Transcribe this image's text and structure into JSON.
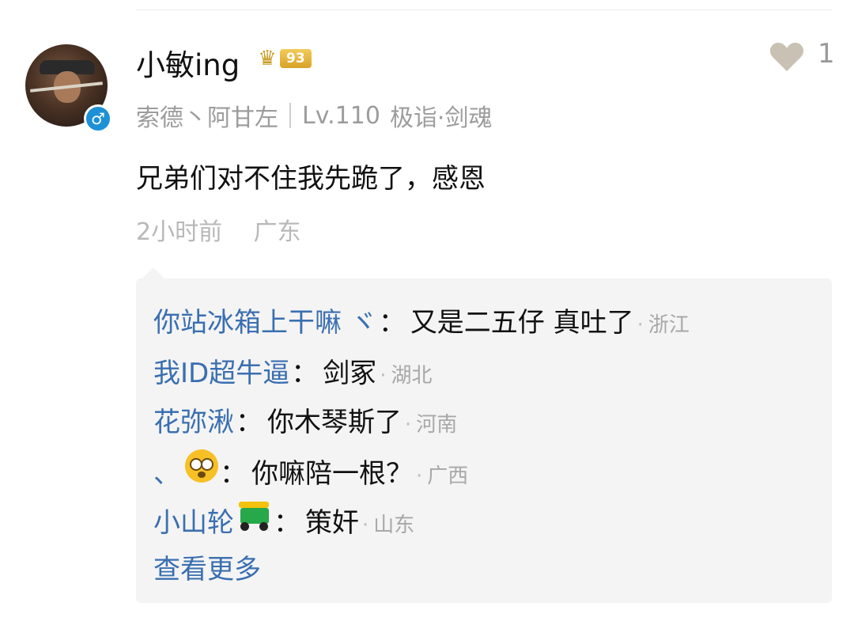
{
  "comment": {
    "username": "小敏ing",
    "level_badge": "93",
    "gender_symbol": "♂",
    "signature": "索德丶阿甘左",
    "level_text": "Lv.110",
    "title_text": "极诣·剑魂",
    "content": "兄弟们对不住我先跪了，感恩",
    "time": "2小时前",
    "location": "广东",
    "like_count": "1"
  },
  "replies": [
    {
      "name": "你站冰箱上干嘛 ヾ",
      "text": "又是二五仔 真吐了",
      "region": "浙江"
    },
    {
      "name": "我ID超牛逼",
      "text": "剑冢",
      "region": "湖北"
    },
    {
      "name": "花弥湫",
      "text": "你木琴斯了",
      "region": "河南"
    },
    {
      "name": "、",
      "icon": "flushed-face-emoji",
      "text": "你嘛陪一根？",
      "region": "广西"
    },
    {
      "name": "小山轮",
      "icon": "auto-rickshaw-emoji",
      "text": "策奸",
      "region": "山东"
    }
  ],
  "reply_colon": "：",
  "region_dot": "·",
  "more_label": "查看更多",
  "colors": {
    "link_blue": "#3a6fb0",
    "gray_text": "#9c9c9c",
    "reply_bg": "#f4f4f4",
    "gender_blue": "#1e90d6",
    "badge_gold": "#d8a227"
  }
}
